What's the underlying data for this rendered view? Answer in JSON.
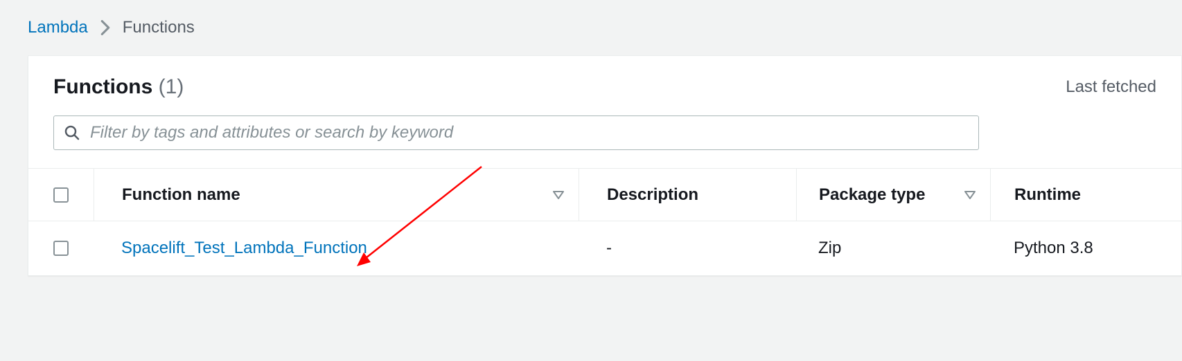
{
  "breadcrumb": {
    "root": "Lambda",
    "current": "Functions"
  },
  "panel": {
    "title": "Functions",
    "count": "(1)",
    "last_fetched": "Last fetched"
  },
  "search": {
    "placeholder": "Filter by tags and attributes or search by keyword"
  },
  "table": {
    "headers": {
      "name": "Function name",
      "description": "Description",
      "package": "Package type",
      "runtime": "Runtime"
    },
    "rows": [
      {
        "name": "Spacelift_Test_Lambda_Function",
        "description": "-",
        "package": "Zip",
        "runtime": "Python 3.8"
      }
    ]
  }
}
